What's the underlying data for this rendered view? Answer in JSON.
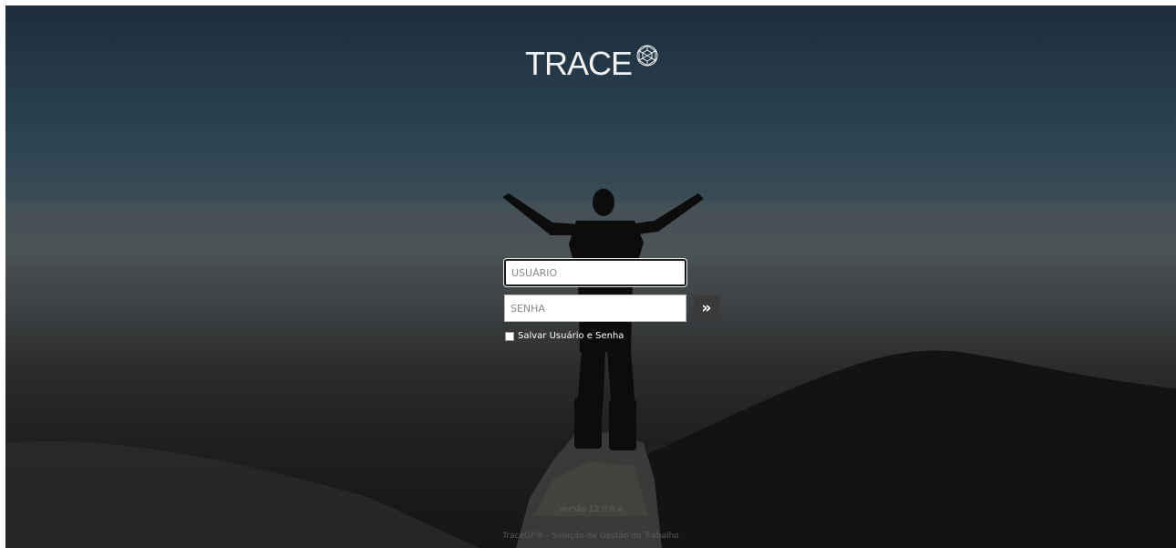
{
  "brand": {
    "name": "TRACE",
    "logo_icon": "geodesic-sphere-icon"
  },
  "login": {
    "username_placeholder": "USUÁRIO",
    "username_value": "",
    "password_placeholder": "SENHA",
    "password_value": "",
    "submit_label": "»",
    "submit_icon": "double-chevron-right-icon",
    "remember_label": "Salvar Usuário e Senha",
    "remember_checked": false
  },
  "footer": {
    "version": "Versão 12.0.0.4",
    "product": "TraceGP® - Solução de Gestão do Trabalho"
  },
  "colors": {
    "sky_top": "#1d2d3a",
    "fog": "#4a5356",
    "ground": "#151515",
    "button_bg": "#3a3a3a"
  }
}
